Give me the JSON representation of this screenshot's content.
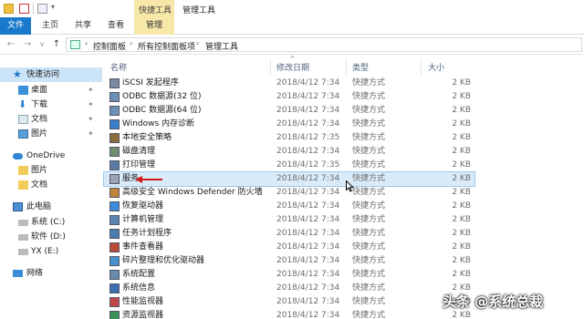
{
  "titlebar": {
    "context_tab": "快捷工具",
    "title": "管理工具"
  },
  "ribbon": {
    "tabs": [
      "文件",
      "主页",
      "共享",
      "查看",
      "管理"
    ]
  },
  "address": {
    "crumbs": [
      "控制面板",
      "所有控制面板项",
      "管理工具"
    ]
  },
  "sidebar": {
    "items": [
      {
        "label": "快速访问",
        "icon": "star-icon"
      },
      {
        "label": "桌面",
        "icon": "desktop-icon",
        "pinned": true
      },
      {
        "label": "下载",
        "icon": "download-icon",
        "pinned": true
      },
      {
        "label": "文档",
        "icon": "document-icon",
        "pinned": true
      },
      {
        "label": "图片",
        "icon": "picture-icon",
        "pinned": true
      },
      {
        "label": "OneDrive",
        "icon": "cloud-icon"
      },
      {
        "label": "图片",
        "icon": "folder-icon"
      },
      {
        "label": "文档",
        "icon": "folder-icon"
      },
      {
        "label": "此电脑",
        "icon": "computer-icon"
      },
      {
        "label": "系统 (C:)",
        "icon": "drive-icon"
      },
      {
        "label": "软件 (D:)",
        "icon": "drive-icon"
      },
      {
        "label": "YX (E:)",
        "icon": "drive-icon"
      },
      {
        "label": "网络",
        "icon": "network-icon"
      }
    ]
  },
  "list": {
    "headers": {
      "name": "名称",
      "date": "修改日期",
      "type": "类型",
      "size": "大小"
    },
    "rows": [
      {
        "name": "iSCSI 发起程序",
        "date": "2018/4/12 7:34",
        "type": "快捷方式",
        "size": "2 KB"
      },
      {
        "name": "ODBC 数据源(32 位)",
        "date": "2018/4/12 7:34",
        "type": "快捷方式",
        "size": "2 KB"
      },
      {
        "name": "ODBC 数据源(64 位)",
        "date": "2018/4/12 7:34",
        "type": "快捷方式",
        "size": "2 KB"
      },
      {
        "name": "Windows 内存诊断",
        "date": "2018/4/12 7:34",
        "type": "快捷方式",
        "size": "2 KB"
      },
      {
        "name": "本地安全策略",
        "date": "2018/4/12 7:35",
        "type": "快捷方式",
        "size": "2 KB"
      },
      {
        "name": "磁盘清理",
        "date": "2018/4/12 7:34",
        "type": "快捷方式",
        "size": "2 KB"
      },
      {
        "name": "打印管理",
        "date": "2018/4/12 7:35",
        "type": "快捷方式",
        "size": "2 KB"
      },
      {
        "name": "服务",
        "date": "2018/4/12 7:34",
        "type": "快捷方式",
        "size": "2 KB"
      },
      {
        "name": "高级安全 Windows Defender 防火墙",
        "date": "2018/4/12 7:34",
        "type": "快捷方式",
        "size": "2 KB"
      },
      {
        "name": "恢复驱动器",
        "date": "2018/4/12 7:34",
        "type": "快捷方式",
        "size": "2 KB"
      },
      {
        "name": "计算机管理",
        "date": "2018/4/12 7:34",
        "type": "快捷方式",
        "size": "2 KB"
      },
      {
        "name": "任务计划程序",
        "date": "2018/4/12 7:34",
        "type": "快捷方式",
        "size": "2 KB"
      },
      {
        "name": "事件查看器",
        "date": "2018/4/12 7:34",
        "type": "快捷方式",
        "size": "2 KB"
      },
      {
        "name": "碎片整理和优化驱动器",
        "date": "2018/4/12 7:34",
        "type": "快捷方式",
        "size": "2 KB"
      },
      {
        "name": "系统配置",
        "date": "2018/4/12 7:34",
        "type": "快捷方式",
        "size": "2 KB"
      },
      {
        "name": "系统信息",
        "date": "2018/4/12 7:34",
        "type": "快捷方式",
        "size": "2 KB"
      },
      {
        "name": "性能监视器",
        "date": "2018/4/12 7:34",
        "type": "快捷方式",
        "size": "2 KB"
      },
      {
        "name": "资源监视器",
        "date": "2018/4/12 7:34",
        "type": "快捷方式",
        "size": "2 KB"
      }
    ]
  },
  "watermark": "头条 @系统总裁",
  "colors": {
    "file_tab": "#1979ca",
    "context_tab": "#f7e7a8",
    "selected_row": "#d9ebf9",
    "arrow": "#d01c1c"
  }
}
